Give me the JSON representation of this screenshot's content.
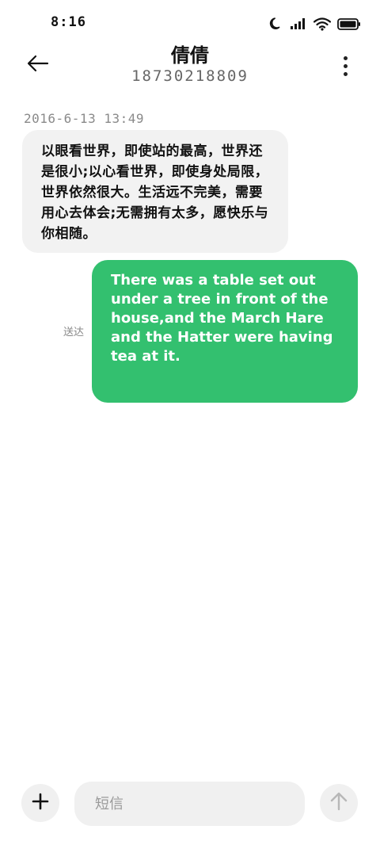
{
  "status_bar": {
    "time": "8:16",
    "icons": [
      "moon-icon",
      "signal-icon",
      "wifi-icon",
      "battery-icon"
    ]
  },
  "header": {
    "contact_name": "倩倩",
    "contact_number": "18730218809",
    "back_icon": "arrow-left-icon",
    "more_icon": "more-vertical-icon"
  },
  "conversation": {
    "timestamp": "2016-6-13 13:49",
    "incoming_text": "以眼看世界，即使站的最高，世界还是很小;以心看世界，即使身处局限，世界依然很大。生活远不完美，需要用心去体会;无需拥有太多，愿快乐与你相随。",
    "outgoing_text": "There was a table set out under a tree in front of the house,and the March Hare and the Hatter were having tea at it.",
    "delivery_status": "送达"
  },
  "composer": {
    "placeholder": "短信",
    "value": "",
    "add_icon": "plus-icon",
    "send_icon": "arrow-up-icon"
  },
  "colors": {
    "outgoing_bubble": "#33c06f",
    "incoming_bubble": "#f2f2f2",
    "input_background": "#f0f0f0"
  }
}
